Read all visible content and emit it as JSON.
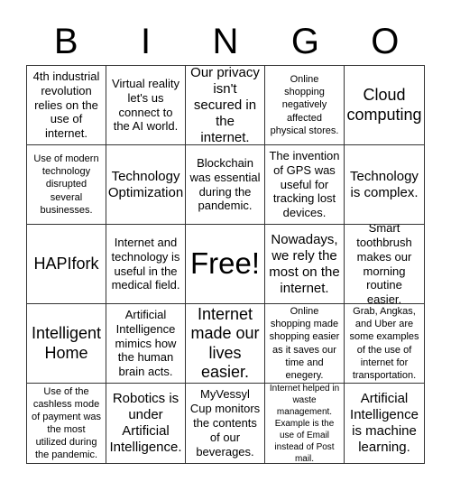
{
  "header": {
    "letters": [
      "B",
      "I",
      "N",
      "G",
      "O"
    ]
  },
  "cells": [
    {
      "text": "4th industrial revolution relies on the use of internet.",
      "size": "s"
    },
    {
      "text": "Virtual reality let's us connect to the AI world.",
      "size": "s"
    },
    {
      "text": "Our privacy isn't secured in the internet.",
      "size": "m"
    },
    {
      "text": "Online shopping negatively affected physical stores.",
      "size": "xs"
    },
    {
      "text": "Cloud computing",
      "size": "l"
    },
    {
      "text": "Use of modern technology disrupted several businesses.",
      "size": "xs"
    },
    {
      "text": "Technology Optimization",
      "size": "m"
    },
    {
      "text": "Blockchain was essential during the pandemic.",
      "size": "s"
    },
    {
      "text": "The invention of GPS was useful for tracking lost devices.",
      "size": "s"
    },
    {
      "text": "Technology is complex.",
      "size": "m"
    },
    {
      "text": "HAPIfork",
      "size": "l"
    },
    {
      "text": "Internet and technology is useful in the medical field.",
      "size": "s"
    },
    {
      "text": "Free!",
      "size": "xl"
    },
    {
      "text": "Nowadays, we rely the most on the internet.",
      "size": "m"
    },
    {
      "text": "Smart toothbrush makes our morning routine easier.",
      "size": "s"
    },
    {
      "text": "Intelligent Home",
      "size": "l"
    },
    {
      "text": "Artificial Intelligence mimics how the human brain acts.",
      "size": "s"
    },
    {
      "text": "Internet made our lives easier.",
      "size": "l"
    },
    {
      "text": "Online shopping made shopping easier as it saves our time and enegery.",
      "size": "xs"
    },
    {
      "text": "Grab, Angkas, and Uber are some examples of the use of internet for transportation.",
      "size": "xs"
    },
    {
      "text": "Use of the cashless mode of payment was the most utilized during the pandemic.",
      "size": "xs"
    },
    {
      "text": "Robotics is under Artificial Intelligence.",
      "size": "m"
    },
    {
      "text": "MyVessyl Cup monitors the contents of our beverages.",
      "size": "s"
    },
    {
      "text": "Internet helped in waste management. Example is the use of Email instead of Post mail.",
      "size": "xxs"
    },
    {
      "text": "Artificial Intelligence is machine learning.",
      "size": "m"
    }
  ]
}
